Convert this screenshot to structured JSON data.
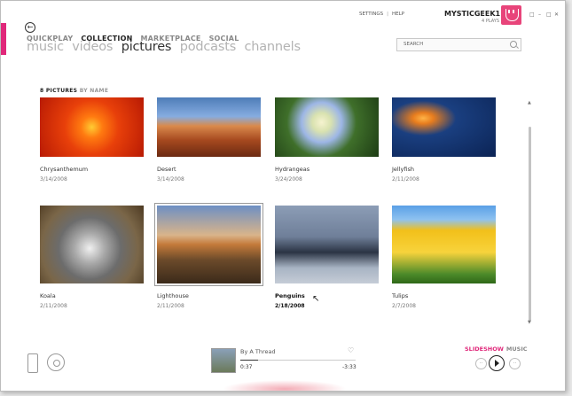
{
  "header": {
    "nav": [
      "QUICKPLAY",
      "COLLECTION",
      "MARKETPLACE",
      "SOCIAL"
    ],
    "nav_active": "COLLECTION",
    "subnav": [
      "music",
      "videos",
      "pictures",
      "podcasts",
      "channels"
    ],
    "subnav_active": "pictures",
    "links": {
      "settings": "SETTINGS",
      "separator": "|",
      "help": "HELP"
    },
    "user": {
      "name": "MYSTICGEEK1",
      "plays": "4 PLAYS"
    },
    "search_placeholder": "SEARCH"
  },
  "collection": {
    "count_label": "8 PICTURES",
    "sort_label": "BY NAME",
    "pictures": [
      {
        "title": "Chrysanthemum",
        "date": "3/14/2008"
      },
      {
        "title": "Desert",
        "date": "3/14/2008"
      },
      {
        "title": "Hydrangeas",
        "date": "3/24/2008"
      },
      {
        "title": "Jellyfish",
        "date": "2/11/2008"
      },
      {
        "title": "Koala",
        "date": "2/11/2008"
      },
      {
        "title": "Lighthouse",
        "date": "2/11/2008"
      },
      {
        "title": "Penguins",
        "date": "2/18/2008"
      },
      {
        "title": "Tulips",
        "date": "2/7/2008"
      }
    ]
  },
  "player": {
    "track": "By A Thread",
    "elapsed": "0:37",
    "remaining": "-3:33",
    "progress_fraction": 0.15,
    "modes": {
      "slideshow": "SLIDESHOW",
      "music": "MUSIC"
    }
  },
  "icons": [
    "back-arrow-icon",
    "search-icon",
    "heart-icon",
    "device-icon",
    "disc-icon",
    "play-icon",
    "previous-icon",
    "next-icon"
  ],
  "colors": {
    "accent": "#e0287a"
  }
}
